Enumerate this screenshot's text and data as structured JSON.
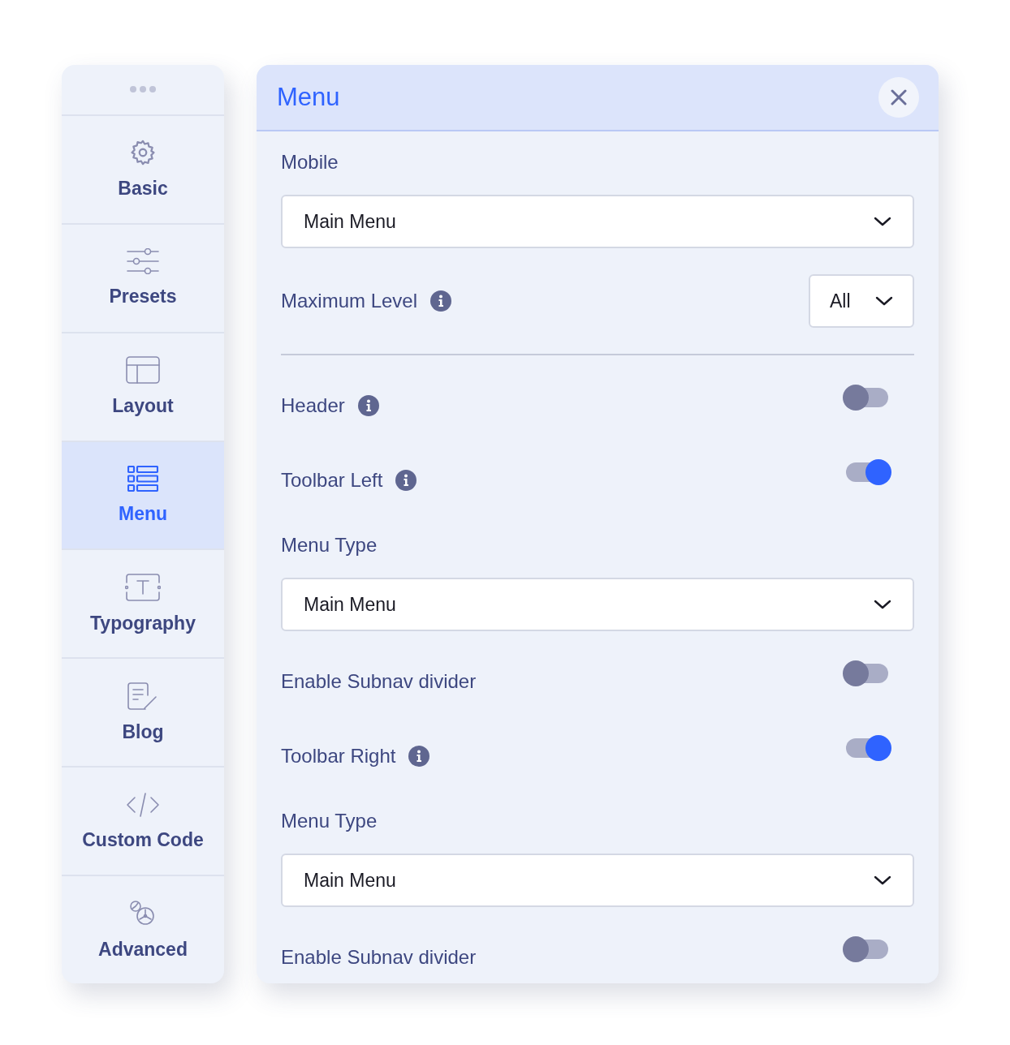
{
  "sidebar": {
    "items": [
      {
        "label": "Basic",
        "selected": false
      },
      {
        "label": "Presets",
        "selected": false
      },
      {
        "label": "Layout",
        "selected": false
      },
      {
        "label": "Menu",
        "selected": true
      },
      {
        "label": "Typography",
        "selected": false
      },
      {
        "label": "Blog",
        "selected": false
      },
      {
        "label": "Custom Code",
        "selected": false
      },
      {
        "label": "Advanced",
        "selected": false
      }
    ]
  },
  "panel": {
    "title": "Menu",
    "fields": [
      {
        "kind": "heading",
        "label": "Mobile"
      },
      {
        "kind": "select",
        "value": "Main Menu"
      },
      {
        "kind": "inline_select",
        "label": "Maximum Level",
        "info": true,
        "value": "All"
      },
      {
        "kind": "divider"
      },
      {
        "kind": "toggle",
        "label": "Header",
        "info": true,
        "on": false
      },
      {
        "kind": "toggle",
        "label": "Toolbar Left",
        "info": true,
        "on": true
      },
      {
        "kind": "heading",
        "label": "Menu Type"
      },
      {
        "kind": "select",
        "value": "Main Menu"
      },
      {
        "kind": "toggle",
        "label": "Enable Subnav divider",
        "info": false,
        "on": false
      },
      {
        "kind": "toggle",
        "label": "Toolbar Right",
        "info": true,
        "on": true
      },
      {
        "kind": "heading",
        "label": "Menu Type"
      },
      {
        "kind": "select",
        "value": "Main Menu"
      },
      {
        "kind": "toggle",
        "label": "Enable Subnav divider",
        "info": false,
        "on": false
      }
    ]
  }
}
